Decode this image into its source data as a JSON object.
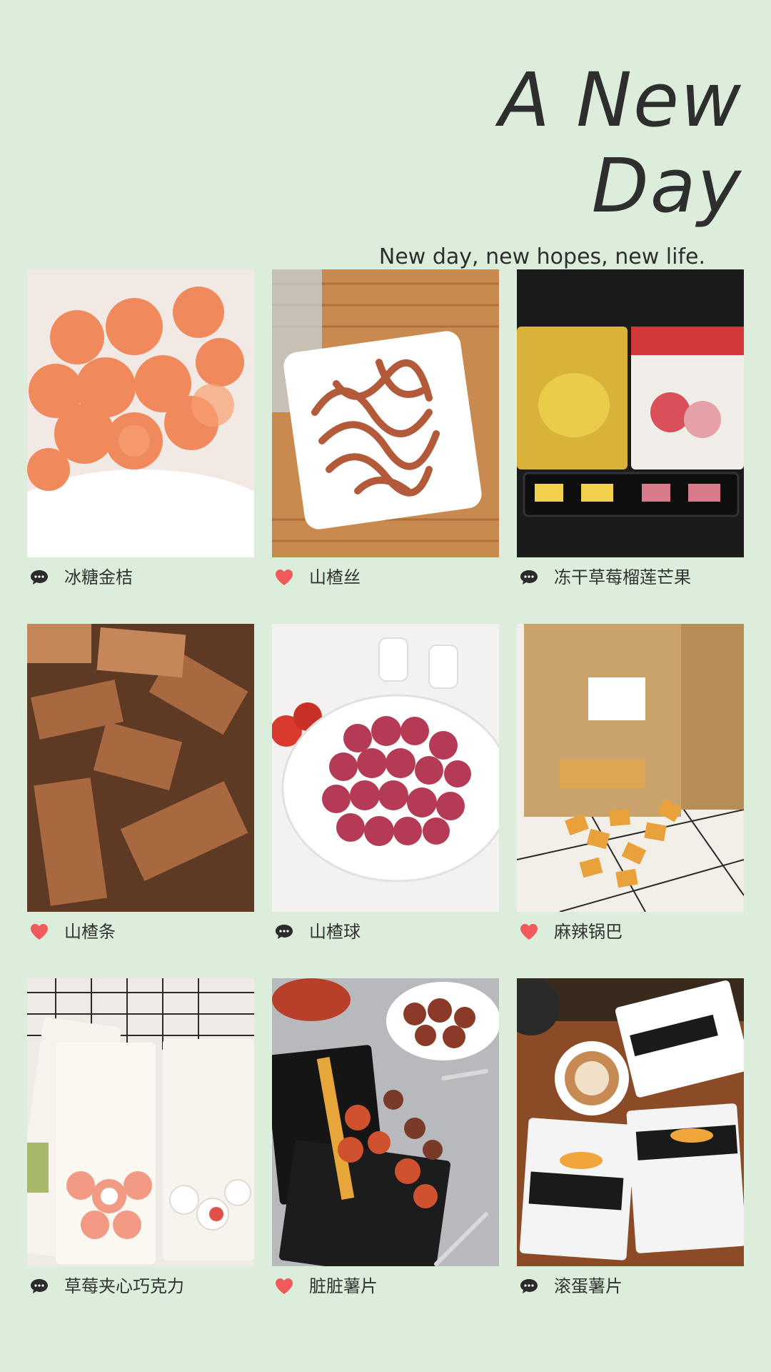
{
  "header": {
    "title": "A New Day",
    "subtitle": "New day, new hopes, new life."
  },
  "colors": {
    "background": "#dceedb",
    "heart": "#f05a5a",
    "chat": "#2b2b2b"
  },
  "items": [
    {
      "label": "冰糖金桔",
      "icon": "chat-bubble-icon"
    },
    {
      "label": "山楂丝",
      "icon": "heart-icon"
    },
    {
      "label": "冻干草莓榴莲芒果",
      "icon": "chat-bubble-icon"
    },
    {
      "label": "山楂条",
      "icon": "heart-icon"
    },
    {
      "label": "山楂球",
      "icon": "chat-bubble-icon"
    },
    {
      "label": "麻辣锅巴",
      "icon": "heart-icon"
    },
    {
      "label": "草莓夹心巧克力",
      "icon": "chat-bubble-icon"
    },
    {
      "label": "脏脏薯片",
      "icon": "heart-icon"
    },
    {
      "label": "滚蛋薯片",
      "icon": "chat-bubble-icon"
    }
  ]
}
